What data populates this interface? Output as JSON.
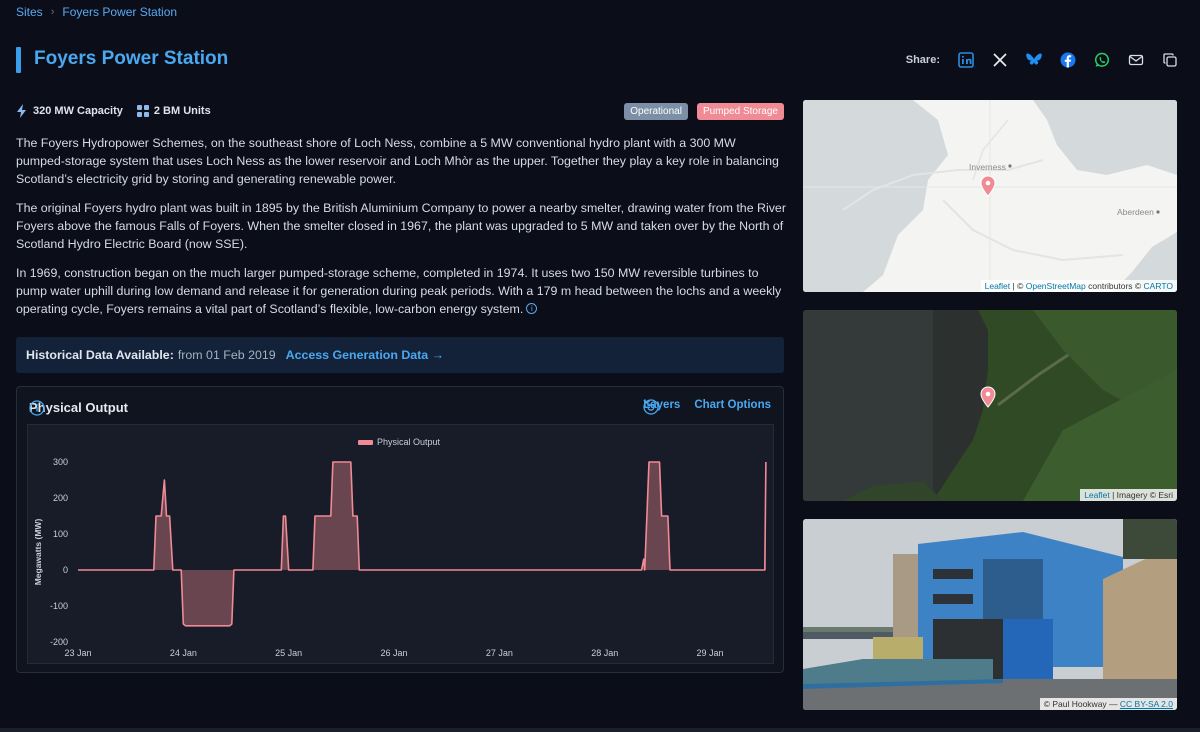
{
  "breadcrumb": {
    "root": "Sites",
    "separator": "›",
    "current": "Foyers Power Station"
  },
  "page": {
    "title": "Foyers Power Station"
  },
  "share": {
    "label": "Share:",
    "icons": [
      "linkedin-icon",
      "x-icon",
      "bluesky-icon",
      "facebook-icon",
      "whatsapp-icon",
      "email-icon",
      "copy-icon"
    ]
  },
  "meta": {
    "capacity": "320 MW Capacity",
    "units": "2 BM Units"
  },
  "tags": {
    "status": "Operational",
    "type": "Pumped Storage"
  },
  "description": {
    "p1": "The Foyers Hydropower Schemes, on the southeast shore of Loch Ness, combine a 5 MW conventional hydro plant with a 300 MW pumped-storage system that uses Loch Ness as the lower reservoir and Loch Mhòr as the upper. Together they play a key role in balancing Scotland’s electricity grid by storing and generating renewable power.",
    "p2": "The original Foyers hydro plant was built in 1895 by the British Aluminium Company to power a nearby smelter, drawing water from the River Foyers above the famous Falls of Foyers. When the smelter closed in 1967, the plant was upgraded to 5 MW and taken over by the North of Scotland Hydro Electric Board (now SSE).",
    "p3": "In 1969, construction began on the much larger pumped-storage scheme, completed in 1974. It uses two 150 MW reversible turbines to pump water uphill during low demand and release it for generation during peak periods. With a 179 m head between the lochs and a weekly operating cycle, Foyers remains a vital part of Scotland’s flexible, low-carbon energy system."
  },
  "historical": {
    "label": "Historical Data Available:",
    "from": "from 01 Feb 2019",
    "link": "Access Generation Data →"
  },
  "chart_panel": {
    "title": "Physical Output",
    "layers": "Layers",
    "options": "Chart Options"
  },
  "chart_data": {
    "type": "area",
    "legend": "Physical Output",
    "ylabel": "Megawatts (MW)",
    "ylim": [
      -200,
      300
    ],
    "yticks": [
      300,
      200,
      100,
      0,
      -100,
      -200
    ],
    "xticks": [
      "23 Jan",
      "24 Jan",
      "25 Jan",
      "26 Jan",
      "27 Jan",
      "28 Jan",
      "29 Jan"
    ],
    "xlim": [
      0,
      6.55
    ],
    "color": "#f08a94",
    "series": [
      {
        "name": "Physical Output",
        "x": [
          0,
          0.72,
          0.74,
          0.76,
          0.79,
          0.82,
          0.84,
          0.85,
          0.87,
          0.9,
          0.92,
          0.98,
          1.0,
          1.02,
          1.44,
          1.46,
          1.48,
          1.93,
          1.95,
          1.97,
          2.0,
          2.02,
          2.23,
          2.25,
          2.4,
          2.42,
          2.59,
          2.61,
          2.65,
          2.67,
          5.35,
          5.37,
          5.38,
          5.4,
          5.42,
          5.52,
          5.54,
          5.6,
          5.62,
          6.5,
          6.52,
          6.53
        ],
        "y": [
          0,
          0,
          150,
          150,
          150,
          250,
          150,
          150,
          150,
          0,
          0,
          0,
          -150,
          -155,
          -155,
          -150,
          0,
          0,
          150,
          150,
          0,
          0,
          0,
          150,
          150,
          300,
          300,
          150,
          150,
          0,
          0,
          30,
          0,
          150,
          300,
          300,
          150,
          150,
          0,
          0,
          0,
          300
        ]
      }
    ]
  },
  "panels": {
    "map1": {
      "city1": "Inverness",
      "city2": "Aberdeen",
      "attrib_leaflet": "Leaflet",
      "attrib_sep": "| ©",
      "attrib_osm": "OpenStreetMap",
      "attrib_mid": "contributors ©",
      "attrib_carto": "CARTO"
    },
    "map2": {
      "attrib_leaflet": "Leaflet",
      "attrib_rest": "| Imagery © Esri"
    },
    "photo": {
      "attrib_author": "© Paul Hookway —",
      "attrib_license": "CC BY-SA 2.0"
    }
  }
}
